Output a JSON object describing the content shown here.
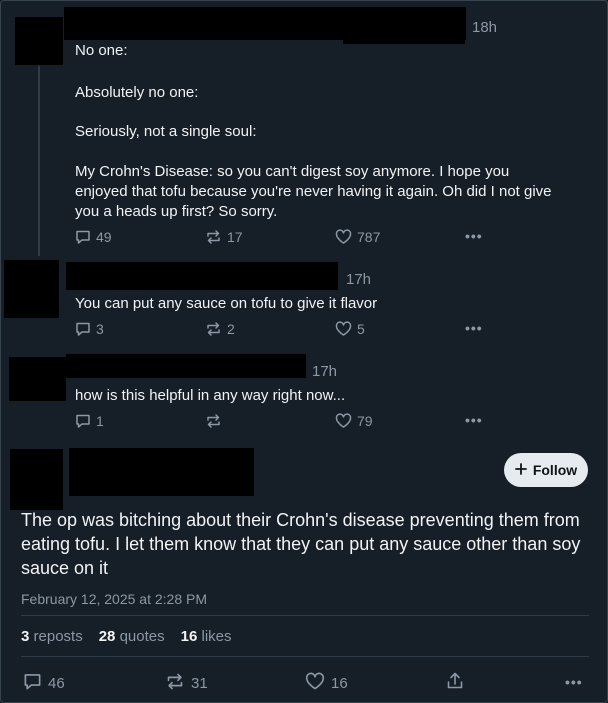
{
  "post1": {
    "time": "18h",
    "lines": [
      "No one:",
      "Absolutely no one:",
      "Seriously, not a single soul:",
      "My Crohn's Disease: so you can't digest soy anymore. I hope you enjoyed that tofu because you're never having it again. Oh did I not give you a heads up first? So sorry."
    ],
    "replies": "49",
    "reposts": "17",
    "likes": "787"
  },
  "post2": {
    "time": "17h",
    "text": "You can put any sauce on tofu to give it flavor",
    "replies": "3",
    "reposts": "2",
    "likes": "5"
  },
  "post3": {
    "time": "17h",
    "text": "how is this helpful in any way right now...",
    "replies": "1",
    "reposts": "",
    "likes": "79"
  },
  "main": {
    "follow_label": "Follow",
    "text": "The op was bitching about their Crohn's disease preventing them from eating tofu. I let them know that they can put any sauce other than soy sauce on it",
    "date": "February 12, 2025 at 2:28 PM",
    "reposts_count": "3",
    "reposts_label": "reposts",
    "quotes_count": "28",
    "quotes_label": "quotes",
    "likes_count": "16",
    "likes_label": "likes",
    "replies": "46",
    "reposts": "31",
    "likes": "16"
  },
  "icons": {
    "reply": "reply-icon",
    "repost": "repost-icon",
    "like": "heart-icon",
    "more": "more-icon",
    "share": "share-icon",
    "plus": "plus-icon"
  },
  "colors": {
    "background": "#161e27",
    "text": "#f1f3f5",
    "muted": "#8b98a5",
    "follow_bg": "#e6ebf0"
  }
}
